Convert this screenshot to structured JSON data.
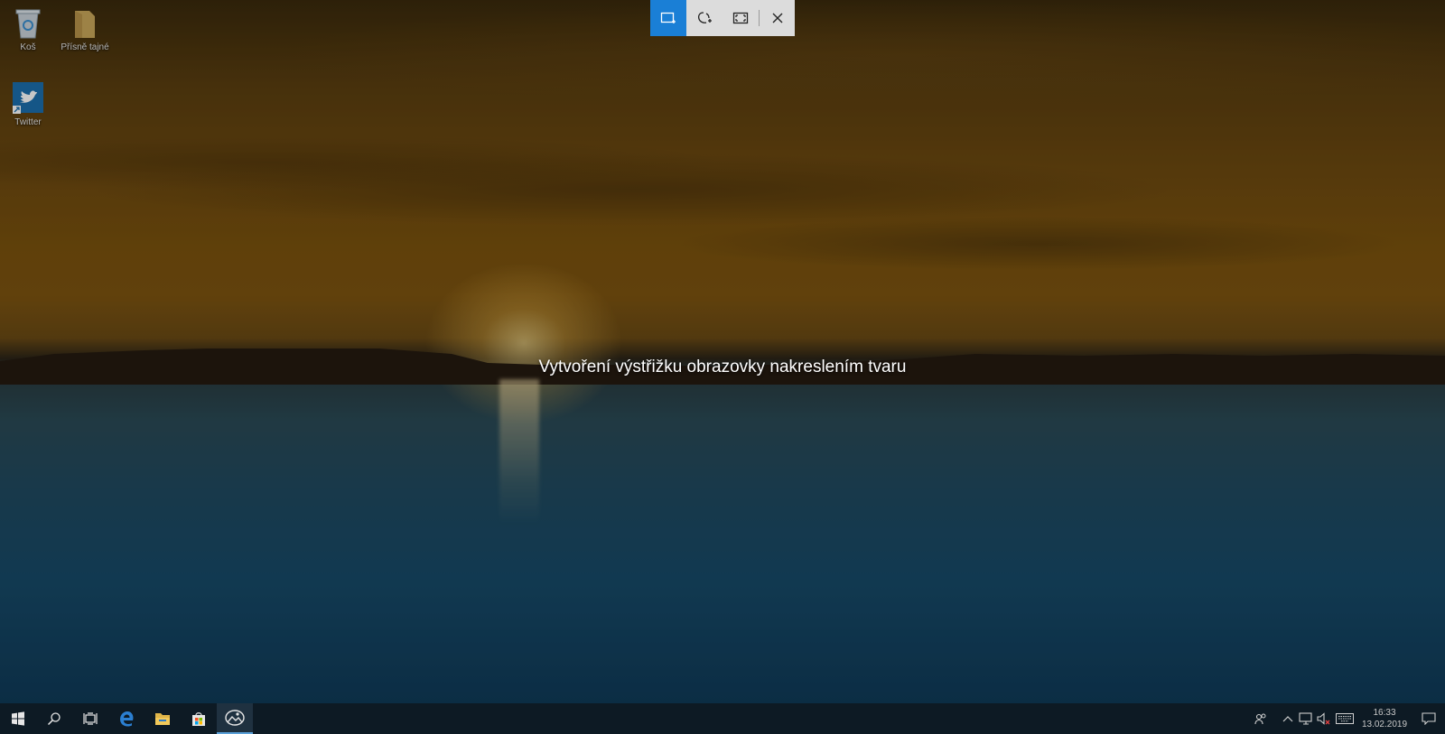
{
  "desktop": {
    "icons": [
      {
        "label": "Koš",
        "icon": "recycle-bin-icon"
      },
      {
        "label": "Přísně tajné",
        "icon": "folder-icon"
      },
      {
        "label": "Twitter",
        "icon": "twitter-icon"
      }
    ],
    "hint_text": "Vytvoření výstřižku obrazovky nakreslením tvaru"
  },
  "snip_toolbar": {
    "buttons": [
      {
        "icon": "rectangular-snip-icon",
        "active": true
      },
      {
        "icon": "freeform-snip-icon",
        "active": false
      },
      {
        "icon": "fullscreen-snip-icon",
        "active": false
      },
      {
        "icon": "close-icon",
        "active": false
      }
    ],
    "accent": "#1a7fd6"
  },
  "taskbar": {
    "apps": [
      {
        "icon": "windows-start-icon"
      },
      {
        "icon": "search-icon"
      },
      {
        "icon": "task-view-icon"
      },
      {
        "icon": "edge-icon"
      },
      {
        "icon": "file-explorer-icon"
      },
      {
        "icon": "store-icon"
      },
      {
        "icon": "snip-sketch-icon",
        "active": true
      }
    ],
    "tray": {
      "icons": [
        "people-icon",
        "chevron-up-icon",
        "network-icon",
        "volume-muted-icon",
        "keyboard-icon"
      ],
      "time": "16:33",
      "date": "13.02.2019"
    }
  }
}
